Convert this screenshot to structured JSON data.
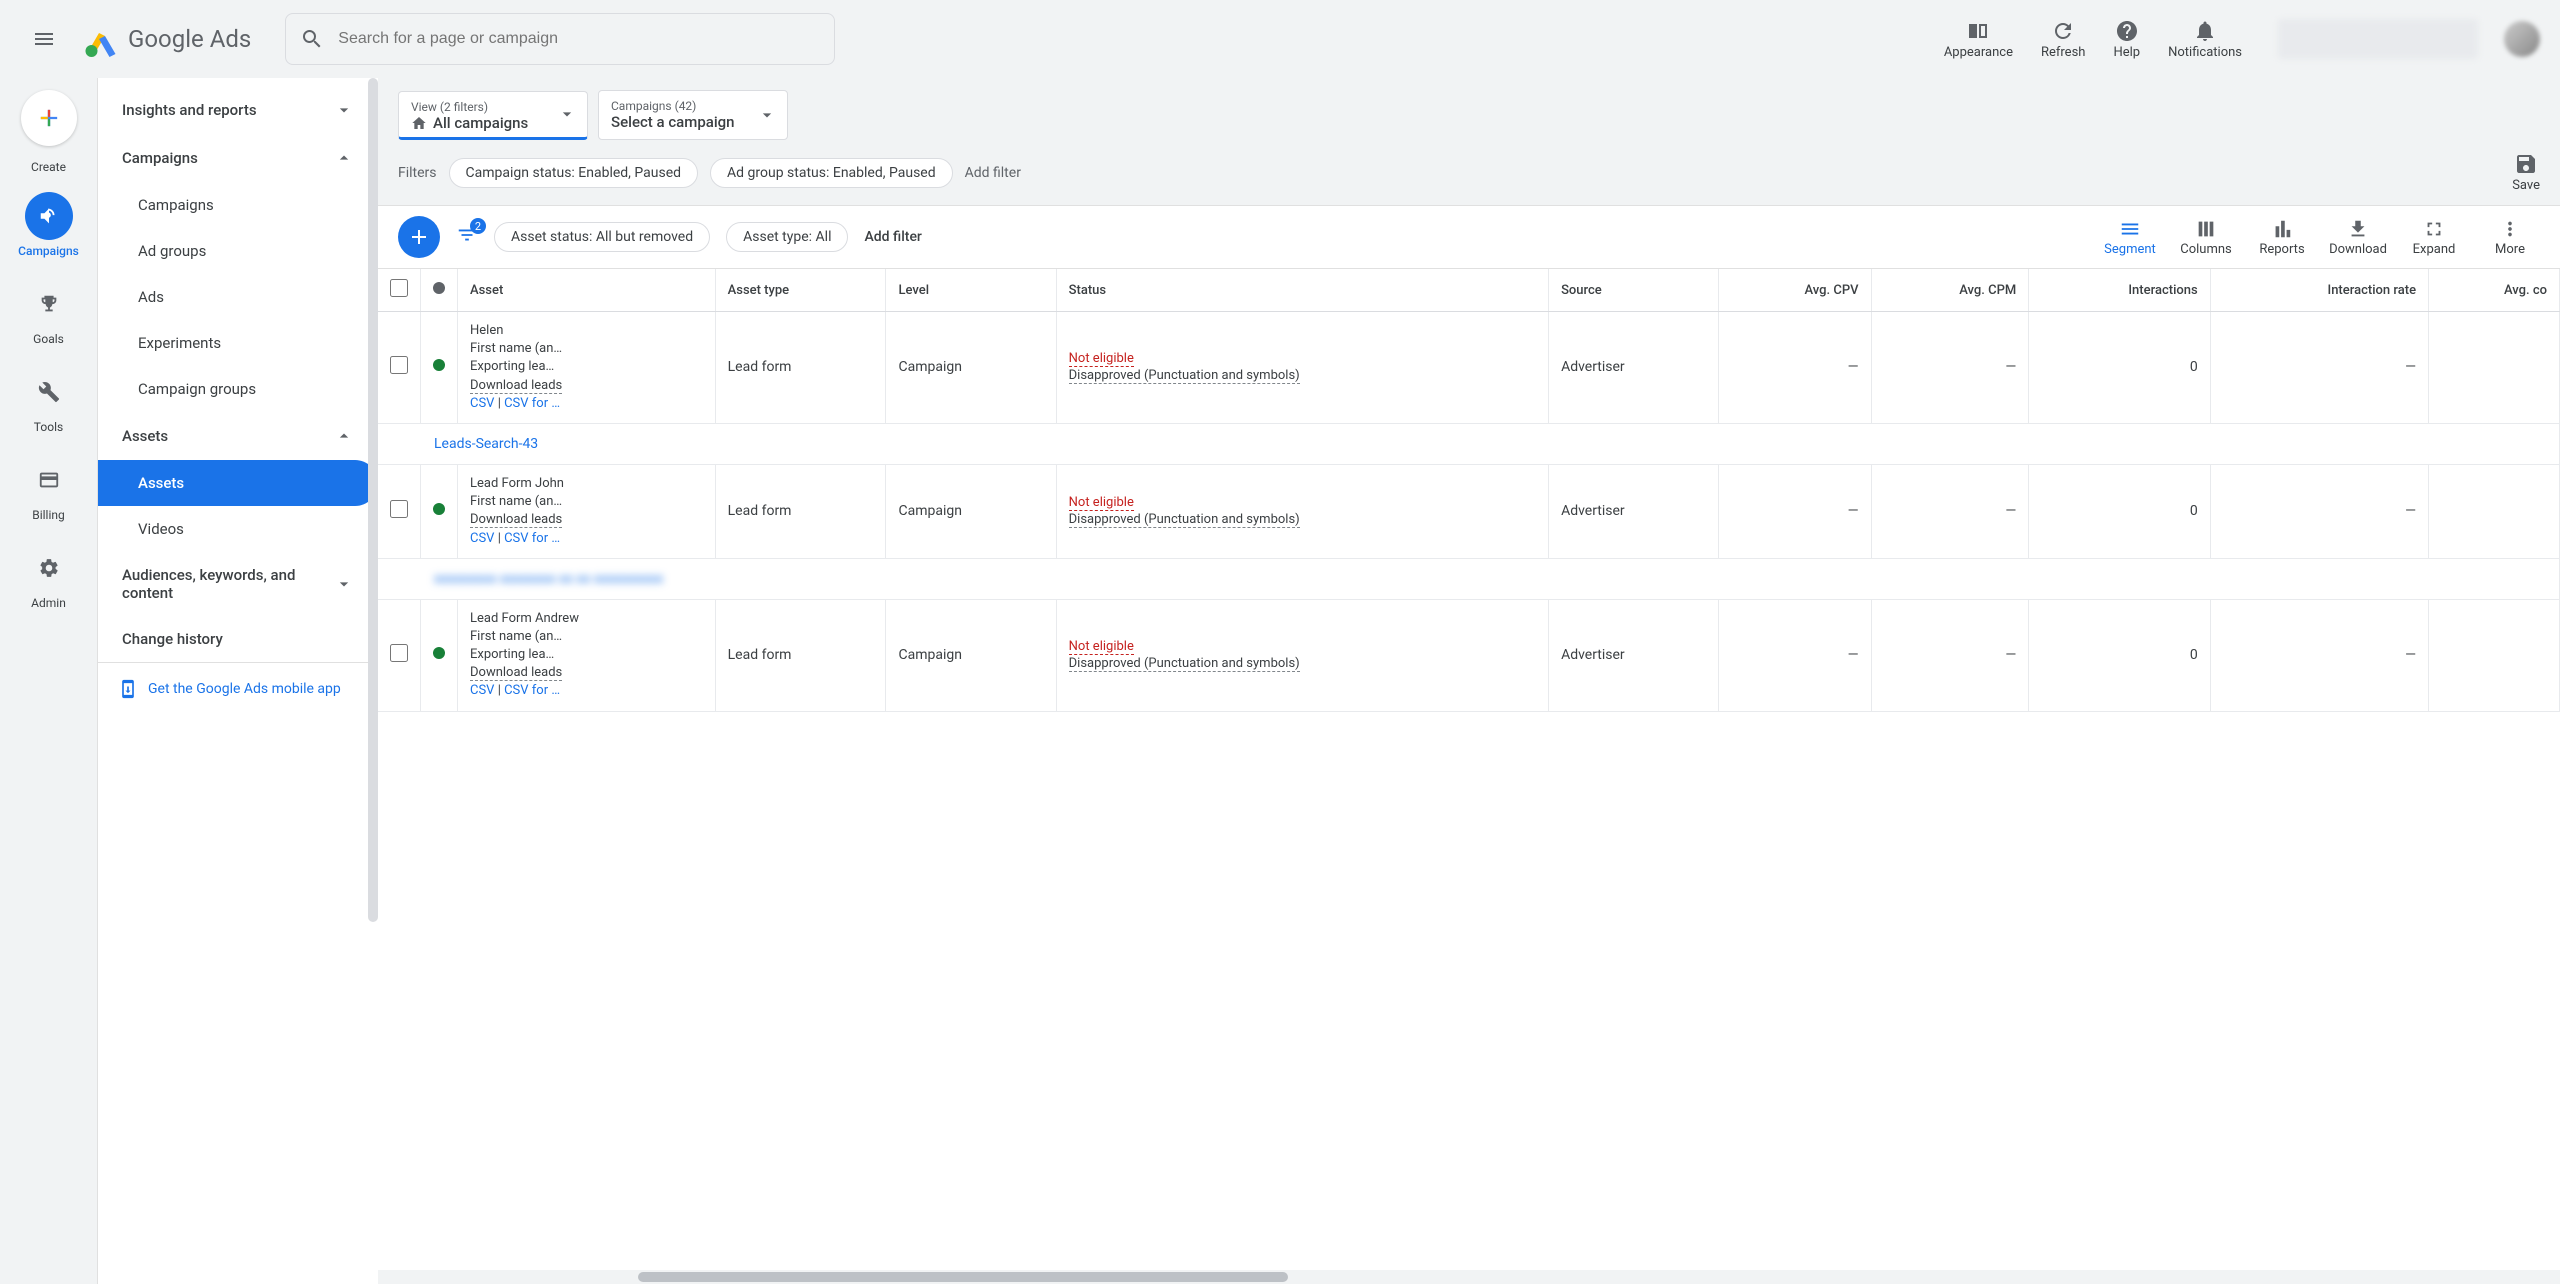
{
  "app": {
    "name": "Google Ads"
  },
  "search": {
    "placeholder": "Search for a page or campaign"
  },
  "header_actions": {
    "appearance": "Appearance",
    "refresh": "Refresh",
    "help": "Help",
    "notifications": "Notifications"
  },
  "left_rail": {
    "create": "Create",
    "campaigns": "Campaigns",
    "goals": "Goals",
    "tools": "Tools",
    "billing": "Billing",
    "admin": "Admin"
  },
  "sidebar": {
    "insights": "Insights and reports",
    "campaigns_section": "Campaigns",
    "campaigns": "Campaigns",
    "ad_groups": "Ad groups",
    "ads": "Ads",
    "experiments": "Experiments",
    "campaign_groups": "Campaign groups",
    "assets_section": "Assets",
    "assets": "Assets",
    "videos": "Videos",
    "audiences": "Audiences, keywords, and content",
    "change_history": "Change history",
    "mobile_app": "Get the Google Ads mobile app"
  },
  "view_bar": {
    "view_label": "View (2 filters)",
    "view_value": "All campaigns",
    "campaigns_label": "Campaigns (42)",
    "campaigns_value": "Select a campaign"
  },
  "filters": {
    "label": "Filters",
    "chip1": "Campaign status: Enabled, Paused",
    "chip2": "Ad group status: Enabled, Paused",
    "add": "Add filter",
    "save": "Save"
  },
  "toolbar": {
    "filter_badge": "2",
    "chip_asset_status": "Asset status: All but removed",
    "chip_asset_type": "Asset type: All",
    "add_filter": "Add filter",
    "segment": "Segment",
    "columns": "Columns",
    "reports": "Reports",
    "download": "Download",
    "expand": "Expand",
    "more": "More"
  },
  "table": {
    "headers": {
      "asset": "Asset",
      "asset_type": "Asset type",
      "level": "Level",
      "status": "Status",
      "source": "Source",
      "avg_cpv": "Avg. CPV",
      "avg_cpm": "Avg. CPM",
      "interactions": "Interactions",
      "interaction_rate": "Interaction rate",
      "avg_cost": "Avg. co"
    },
    "group1": "Leads-Search-43",
    "group2_blur": "xxxxxxxxx xxxxxxxx xx xx xxxxxxxxxx",
    "rows": [
      {
        "name_line1": "Helen",
        "name_line2": "First name (an…",
        "name_line3": "Exporting lea…",
        "download": "Download leads",
        "csv": "CSV",
        "csv_for": "CSV for …",
        "asset_type": "Lead form",
        "level": "Campaign",
        "status1": "Not eligible",
        "status2": "Disapproved (Punctuation and symbols)",
        "source": "Advertiser",
        "cpv": "—",
        "cpm": "—",
        "interactions": "0",
        "rate": "—"
      },
      {
        "name_line1": "Lead Form John",
        "name_line2": "First name (an…",
        "name_line3": "",
        "download": "Download leads",
        "csv": "CSV",
        "csv_for": "CSV for …",
        "asset_type": "Lead form",
        "level": "Campaign",
        "status1": "Not eligible",
        "status2": "Disapproved (Punctuation and symbols)",
        "source": "Advertiser",
        "cpv": "—",
        "cpm": "—",
        "interactions": "0",
        "rate": "—"
      },
      {
        "name_line1": "Lead Form Andrew",
        "name_line2": "First name (an…",
        "name_line3": "Exporting lea…",
        "download": "Download leads",
        "csv": "CSV",
        "csv_for": "CSV for …",
        "asset_type": "Lead form",
        "level": "Campaign",
        "status1": "Not eligible",
        "status2": "Disapproved (Punctuation and symbols)",
        "source": "Advertiser",
        "cpv": "—",
        "cpm": "—",
        "interactions": "0",
        "rate": "—"
      }
    ]
  }
}
